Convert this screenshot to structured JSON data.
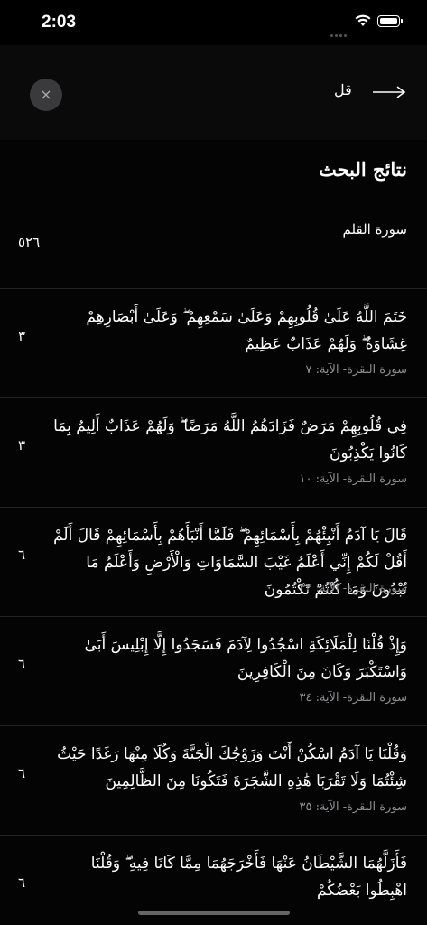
{
  "status": {
    "time": "2:03"
  },
  "search": {
    "query": "قل",
    "clear_icon": "×"
  },
  "results": {
    "title": "نتائج البحث",
    "surah": {
      "name": "سورة القلم",
      "count": "٥٢٦"
    },
    "ayahs": [
      {
        "text": "خَتَمَ اللَّهُ عَلَىٰ قُلُوبِهِمْ وَعَلَىٰ سَمْعِهِمْ ۖ وَعَلَىٰ أَبْصَارِهِمْ غِشَاوَةٌ ۖ وَلَهُمْ عَذَابٌ عَظِيمٌ",
        "ref": "سورة البقرة- الآية: ٧",
        "count": "٣"
      },
      {
        "text": "فِي قُلُوبِهِمْ مَرَضٌ فَزَادَهُمُ اللَّهُ مَرَضًا ۖ وَلَهُمْ عَذَابٌ أَلِيمٌ بِمَا كَانُوا يَكْذِبُونَ",
        "ref": "سورة البقرة- الآية: ١٠",
        "count": "٣"
      },
      {
        "text": "قَالَ يَا آدَمُ أَنْبِئْهُمْ بِأَسْمَائِهِمْ ۖ فَلَمَّا أَنْبَأَهُمْ بِأَسْمَائِهِمْ قَالَ أَلَمْ أَقُلْ لَكُمْ إِنِّي أَعْلَمُ غَيْبَ السَّمَاوَاتِ وَالْأَرْضِ وَأَعْلَمُ مَا تُبْدُونَ وَمَا كُنْتُمْ تَكْتُمُونَ",
        "ref": "سورة البقرة- الآية: ٣٣",
        "count": "٦"
      },
      {
        "text": "وَإِذْ قُلْنَا لِلْمَلَائِكَةِ اسْجُدُوا لِآدَمَ فَسَجَدُوا إِلَّا إِبْلِيسَ أَبَىٰ وَاسْتَكْبَرَ وَكَانَ مِنَ الْكَافِرِينَ",
        "ref": "سورة البقرة- الآية: ٣٤",
        "count": "٦"
      },
      {
        "text": "وَقُلْنَا يَا آدَمُ اسْكُنْ أَنْتَ وَزَوْجُكَ الْجَنَّةَ وَكُلَا مِنْهَا رَغَدًا حَيْثُ شِئْتُمَا وَلَا تَقْرَبَا هَٰذِهِ الشَّجَرَةَ فَتَكُونَا مِنَ الظَّالِمِينَ",
        "ref": "سورة البقرة- الآية: ٣٥",
        "count": "٦"
      },
      {
        "text": "فَأَزَلَّهُمَا الشَّيْطَانُ عَنْهَا فَأَخْرَجَهُمَا مِمَّا كَانَا فِيهِ ۖ وَقُلْنَا اهْبِطُوا بَعْضُكُمْ",
        "ref": "",
        "count": "٦"
      }
    ]
  }
}
